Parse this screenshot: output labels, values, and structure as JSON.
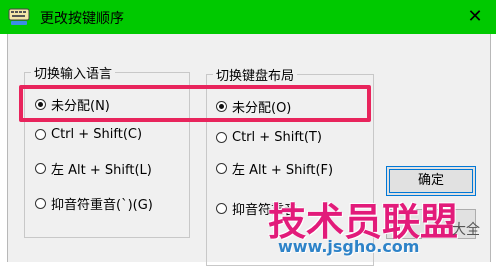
{
  "window": {
    "title": "更改按键顺序",
    "close_glyph": "✕"
  },
  "input_language_group": {
    "legend": "切换输入语言",
    "options": [
      {
        "label": "未分配(N)",
        "selected": true
      },
      {
        "label": "Ctrl + Shift(C)",
        "selected": false
      },
      {
        "label": "左 Alt + Shift(L)",
        "selected": false
      },
      {
        "label": "抑音符重音(`)(G)",
        "selected": false
      }
    ]
  },
  "keyboard_layout_group": {
    "legend": "切换键盘布局",
    "options": [
      {
        "label": "未分配(O)",
        "selected": true
      },
      {
        "label": "Ctrl + Shift(T)",
        "selected": false
      },
      {
        "label": "左 Alt + Shift(F)",
        "selected": false
      },
      {
        "label": "抑音符重音",
        "selected": false
      }
    ]
  },
  "buttons": {
    "ok": "确定"
  },
  "watermark": {
    "main": "技术员联盟",
    "side": "大全",
    "url": "www.jsgho.com"
  },
  "colors": {
    "titlebar": "#00c900",
    "highlight": "#e8245c",
    "accent": "#0078d7"
  }
}
